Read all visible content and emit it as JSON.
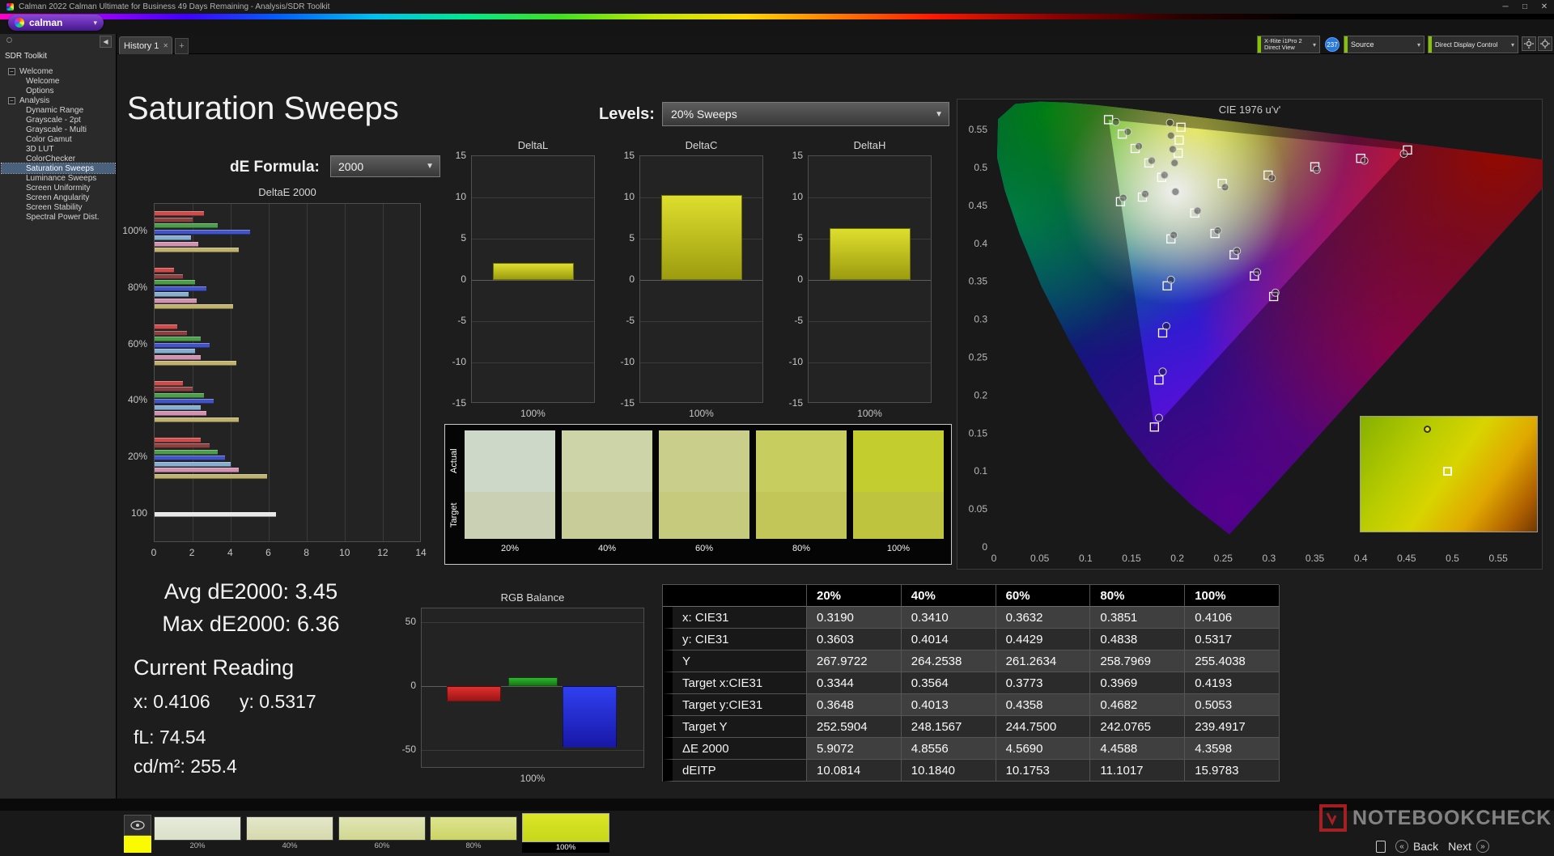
{
  "window": {
    "title": "Calman 2022 Calman Ultimate for Business 49 Days Remaining  - Analysis/SDR Toolkit",
    "brand": "calman",
    "minimize": "─",
    "maximize": "□",
    "close": "✕"
  },
  "tab_bar": {
    "history_tab": "History 1",
    "close_glyph": "✕",
    "new_tab": "+"
  },
  "meter_bar": {
    "meter_line1": "X-Rite i1Pro 2",
    "meter_line2": "Direct View",
    "badge_count": "237",
    "source_label": "Source",
    "display_control_label": "Direct Display Control"
  },
  "sidebar": {
    "title": "SDR Toolkit",
    "tree": [
      {
        "label": "Welcome",
        "type": "group"
      },
      {
        "label": "Welcome",
        "type": "item"
      },
      {
        "label": "Options",
        "type": "item"
      },
      {
        "label": "Analysis",
        "type": "group"
      },
      {
        "label": "Dynamic Range",
        "type": "item"
      },
      {
        "label": "Grayscale - 2pt",
        "type": "item"
      },
      {
        "label": "Grayscale - Multi",
        "type": "item"
      },
      {
        "label": "Color Gamut",
        "type": "item"
      },
      {
        "label": "3D LUT",
        "type": "item"
      },
      {
        "label": "ColorChecker",
        "type": "item"
      },
      {
        "label": "Saturation Sweeps",
        "type": "item",
        "selected": true
      },
      {
        "label": "Luminance Sweeps",
        "type": "item"
      },
      {
        "label": "Screen Uniformity",
        "type": "item"
      },
      {
        "label": "Screen Angularity",
        "type": "item"
      },
      {
        "label": "Screen Stability",
        "type": "item"
      },
      {
        "label": "Spectral Power Dist.",
        "type": "item"
      }
    ]
  },
  "page": {
    "title": "Saturation Sweeps",
    "levels_label": "Levels:",
    "levels_value": "20% Sweeps",
    "formula_label": "dE Formula:",
    "formula_value": "2000"
  },
  "readings": {
    "avg": "Avg dE2000: 3.45",
    "max": "Max dE2000: 6.36",
    "current_heading": "Current Reading",
    "x": "x: 0.4106",
    "y": "y: 0.5317",
    "fl": "fL: 74.54",
    "cd": "cd/m²: 255.4"
  },
  "swatch_panel": {
    "row_labels": [
      "Actual",
      "Target"
    ],
    "levels": [
      "20%",
      "40%",
      "60%",
      "80%",
      "100%"
    ],
    "actual_colors": [
      "#cdd8c8",
      "#ccd4a8",
      "#c9cf8a",
      "#c7cd5e",
      "#c3cd2e"
    ],
    "target_colors": [
      "#cad0b4",
      "#c8cc98",
      "#c5ca7c",
      "#c2c658",
      "#bec43e"
    ]
  },
  "table": {
    "headers": [
      "",
      "20%",
      "40%",
      "60%",
      "80%",
      "100%"
    ],
    "rows": [
      {
        "label": "x: CIE31",
        "values": [
          "0.3190",
          "0.3410",
          "0.3632",
          "0.3851",
          "0.4106"
        ]
      },
      {
        "label": "y: CIE31",
        "values": [
          "0.3603",
          "0.4014",
          "0.4429",
          "0.4838",
          "0.5317"
        ]
      },
      {
        "label": "Y",
        "values": [
          "267.9722",
          "264.2538",
          "261.2634",
          "258.7969",
          "255.4038"
        ]
      },
      {
        "label": "Target x:CIE31",
        "values": [
          "0.3344",
          "0.3564",
          "0.3773",
          "0.3969",
          "0.4193"
        ]
      },
      {
        "label": "Target y:CIE31",
        "values": [
          "0.3648",
          "0.4013",
          "0.4358",
          "0.4682",
          "0.5053"
        ]
      },
      {
        "label": "Target Y",
        "values": [
          "252.5904",
          "248.1567",
          "244.7500",
          "242.0765",
          "239.4917"
        ]
      },
      {
        "label": "ΔE 2000",
        "values": [
          "5.9072",
          "4.8556",
          "4.5690",
          "4.4588",
          "4.3598"
        ]
      },
      {
        "label": "dEITP",
        "values": [
          "10.0814",
          "10.1840",
          "10.1753",
          "11.1017",
          "15.9783"
        ]
      }
    ]
  },
  "footer": {
    "tiles": [
      {
        "label": "20%",
        "color": "#dde2cc",
        "selected": false
      },
      {
        "label": "40%",
        "color": "#d9dcb2",
        "selected": false
      },
      {
        "label": "60%",
        "color": "#d4da96",
        "selected": false
      },
      {
        "label": "80%",
        "color": "#cfd76e",
        "selected": false
      },
      {
        "label": "100%",
        "color": "#cbda1d",
        "selected": true
      }
    ],
    "watermark": "NOTEBOOKCHECK",
    "back_label": "Back",
    "next_label": "Next",
    "back_chevron": "«",
    "next_chevron": "»"
  },
  "chart_data": [
    {
      "id": "deltae2000",
      "type": "bar",
      "title": "DeltaE 2000",
      "orientation": "horizontal",
      "xlim": [
        0,
        14
      ],
      "x_ticks": [
        0,
        2,
        4,
        6,
        8,
        10,
        12,
        14
      ],
      "group_labels": [
        "100%",
        "80%",
        "60%",
        "40%",
        "20%",
        "100"
      ],
      "bar_colors": [
        "#cf4a4a",
        "#8a4040",
        "#4a9e4a",
        "#4253c9",
        "#85aed0",
        "#d391b0",
        "#beb26e"
      ],
      "groups": [
        [
          2.6,
          2.0,
          3.3,
          5.0,
          1.9,
          2.3,
          4.4
        ],
        [
          1.0,
          1.5,
          2.1,
          2.7,
          1.8,
          2.2,
          4.1
        ],
        [
          1.2,
          1.7,
          2.4,
          2.9,
          2.1,
          2.4,
          4.3
        ],
        [
          1.5,
          2.0,
          2.6,
          3.1,
          2.4,
          2.7,
          4.4
        ],
        [
          2.4,
          2.9,
          3.3,
          3.7,
          4.0,
          4.4,
          5.9
        ],
        [
          6.36
        ]
      ],
      "last_group_color": "#e8e8e8"
    },
    {
      "id": "deltaL",
      "type": "bar",
      "title": "DeltaL",
      "ylim": [
        -15,
        15
      ],
      "y_ticks": [
        15,
        10,
        5,
        0,
        -5,
        -10,
        -15
      ],
      "categories": [
        "100%"
      ],
      "values": [
        2.1
      ],
      "bar_color": "#c9c91e"
    },
    {
      "id": "deltaC",
      "type": "bar",
      "title": "DeltaC",
      "ylim": [
        -15,
        15
      ],
      "y_ticks": [
        15,
        10,
        5,
        0,
        -5,
        -10,
        -15
      ],
      "categories": [
        "100%"
      ],
      "values": [
        10.3
      ],
      "bar_color": "#c9c91e"
    },
    {
      "id": "deltaH",
      "type": "bar",
      "title": "DeltaH",
      "ylim": [
        -15,
        15
      ],
      "y_ticks": [
        15,
        10,
        5,
        0,
        -5,
        -10,
        -15
      ],
      "categories": [
        "100%"
      ],
      "values": [
        6.3
      ],
      "bar_color": "#c9c91e"
    },
    {
      "id": "rgb_balance",
      "type": "bar",
      "title": "RGB Balance",
      "ylim": [
        -50,
        50
      ],
      "y_ticks": [
        50,
        0,
        -50
      ],
      "categories": [
        "100%"
      ],
      "series": [
        {
          "name": "Red",
          "value": -12,
          "color_top": "#e03030",
          "color_bottom": "#9c1515"
        },
        {
          "name": "Green",
          "value": 7,
          "color_top": "#2fb52f",
          "color_bottom": "#157a15"
        },
        {
          "name": "Blue",
          "value": -48,
          "color_top": "#3040f0",
          "color_bottom": "#1818a8"
        }
      ]
    },
    {
      "id": "cie",
      "type": "scatter",
      "title": "CIE 1976 u'v'",
      "xlim": [
        0,
        0.55
      ],
      "ylim": [
        0,
        0.55
      ],
      "x_ticks": [
        "0",
        "0.05",
        "0.1",
        "0.15",
        "0.2",
        "0.25",
        "0.3",
        "0.35",
        "0.4",
        "0.45",
        "0.5",
        "0.55"
      ],
      "y_ticks": [
        "0.55",
        "0.5",
        "0.45",
        "0.4",
        "0.35",
        "0.3",
        "0.25",
        "0.2",
        "0.15",
        "0.1",
        "0.05",
        "0"
      ],
      "locus": [
        [
          0.2568,
          0.0166
        ],
        [
          0.2161,
          0.0549
        ],
        [
          0.1877,
          0.0871
        ],
        [
          0.169,
          0.112
        ],
        [
          0.1441,
          0.151
        ],
        [
          0.1147,
          0.2044
        ],
        [
          0.0828,
          0.2708
        ],
        [
          0.0521,
          0.3427
        ],
        [
          0.0282,
          0.4117
        ],
        [
          0.0119,
          0.4698
        ],
        [
          0.0035,
          0.5131
        ],
        [
          0.0046,
          0.5638
        ],
        [
          0.0231,
          0.5837
        ],
        [
          0.0501,
          0.5868
        ],
        [
          0.0792,
          0.5856
        ],
        [
          0.1127,
          0.5821
        ],
        [
          0.1531,
          0.5766
        ],
        [
          0.2026,
          0.5694
        ],
        [
          0.2623,
          0.5604
        ],
        [
          0.3315,
          0.5501
        ],
        [
          0.4034,
          0.5393
        ],
        [
          0.4692,
          0.5295
        ],
        [
          0.5202,
          0.5219
        ],
        [
          0.5565,
          0.5165
        ],
        [
          0.6005,
          0.5099
        ],
        [
          0.6234,
          0.5065
        ]
      ],
      "gamut_triangle": [
        [
          0.451,
          0.523
        ],
        [
          0.125,
          0.563
        ],
        [
          0.175,
          0.158
        ]
      ],
      "target_points": [
        [
          0.249,
          0.479
        ],
        [
          0.299,
          0.49
        ],
        [
          0.35,
          0.501
        ],
        [
          0.4,
          0.512
        ],
        [
          0.451,
          0.523
        ],
        [
          0.183,
          0.487
        ],
        [
          0.169,
          0.506
        ],
        [
          0.154,
          0.525
        ],
        [
          0.14,
          0.544
        ],
        [
          0.125,
          0.563
        ],
        [
          0.193,
          0.406
        ],
        [
          0.189,
          0.344
        ],
        [
          0.184,
          0.282
        ],
        [
          0.18,
          0.22
        ],
        [
          0.175,
          0.158
        ],
        [
          0.219,
          0.44
        ],
        [
          0.241,
          0.413
        ],
        [
          0.262,
          0.385
        ],
        [
          0.284,
          0.357
        ],
        [
          0.305,
          0.33
        ],
        [
          0.162,
          0.461
        ],
        [
          0.138,
          0.455
        ],
        [
          0.201,
          0.519
        ],
        [
          0.202,
          0.536
        ],
        [
          0.204,
          0.553
        ]
      ],
      "measured_points": [
        [
          0.252,
          0.474
        ],
        [
          0.303,
          0.486
        ],
        [
          0.352,
          0.497
        ],
        [
          0.404,
          0.509
        ],
        [
          0.447,
          0.518
        ],
        [
          0.186,
          0.49
        ],
        [
          0.172,
          0.509
        ],
        [
          0.158,
          0.528
        ],
        [
          0.146,
          0.547
        ],
        [
          0.133,
          0.56
        ],
        [
          0.196,
          0.411
        ],
        [
          0.193,
          0.352
        ],
        [
          0.188,
          0.291
        ],
        [
          0.184,
          0.231
        ],
        [
          0.18,
          0.17
        ],
        [
          0.222,
          0.443
        ],
        [
          0.244,
          0.417
        ],
        [
          0.265,
          0.39
        ],
        [
          0.287,
          0.362
        ],
        [
          0.307,
          0.335
        ],
        [
          0.165,
          0.465
        ],
        [
          0.141,
          0.46
        ],
        [
          0.197,
          0.506
        ],
        [
          0.195,
          0.524
        ],
        [
          0.193,
          0.542
        ],
        [
          0.192,
          0.559
        ],
        [
          0.198,
          0.468
        ]
      ]
    }
  ]
}
